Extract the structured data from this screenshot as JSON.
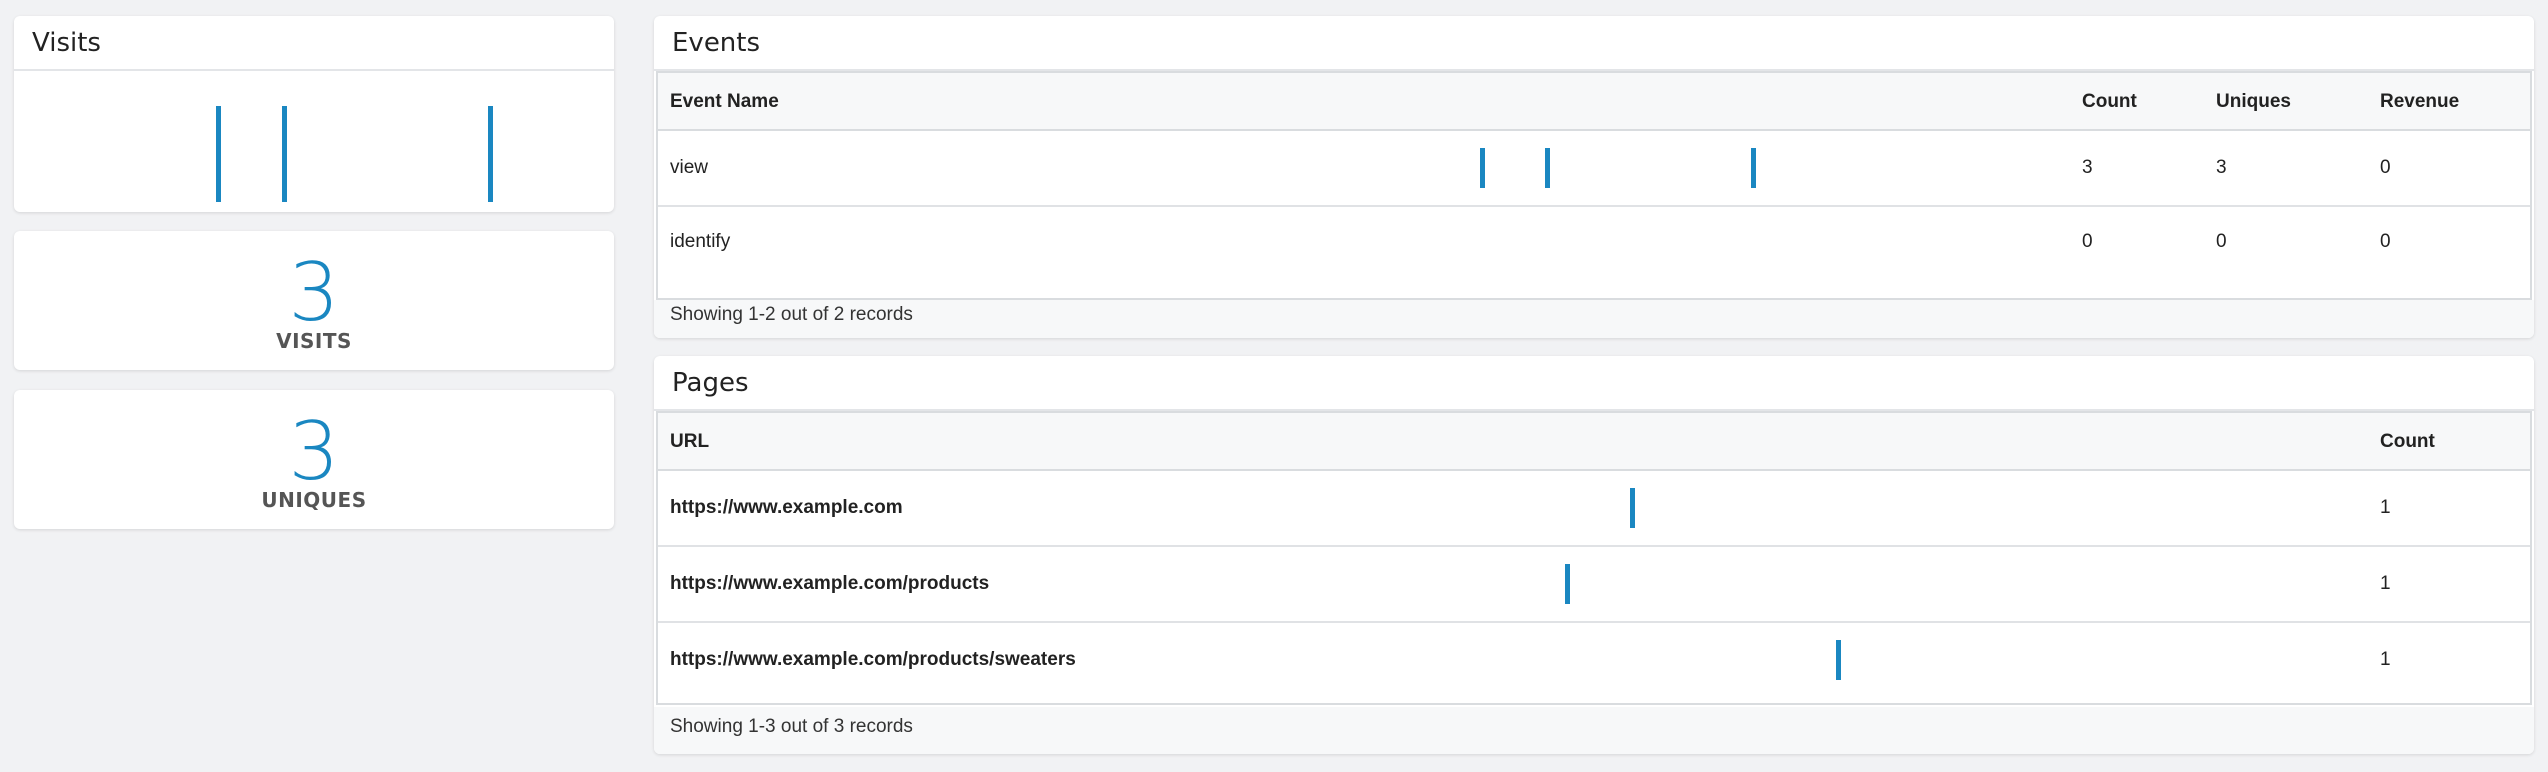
{
  "visits_panel": {
    "title": "Visits"
  },
  "metrics": [
    {
      "value": "3",
      "label": "VISITS"
    },
    {
      "value": "3",
      "label": "UNIQUES"
    }
  ],
  "events": {
    "title": "Events",
    "columns": [
      "Event Name",
      "Count",
      "Uniques",
      "Revenue"
    ],
    "rows": [
      {
        "name": "view",
        "count": "3",
        "uniques": "3",
        "revenue": "0"
      },
      {
        "name": "identify",
        "count": "0",
        "uniques": "0",
        "revenue": "0"
      }
    ],
    "footer": "Showing 1-2 out of 2 records"
  },
  "pages": {
    "title": "Pages",
    "columns": [
      "URL",
      "Count"
    ],
    "rows": [
      {
        "url": "https://www.example.com",
        "count": "1"
      },
      {
        "url": "https://www.example.com/products",
        "count": "1"
      },
      {
        "url": "https://www.example.com/products/sweaters",
        "count": "1"
      }
    ],
    "footer": "Showing 1-3 out of 3 records"
  },
  "colors": {
    "accent": "#1a87c1",
    "background": "#f1f2f4",
    "header_bg": "#f7f8f9"
  }
}
